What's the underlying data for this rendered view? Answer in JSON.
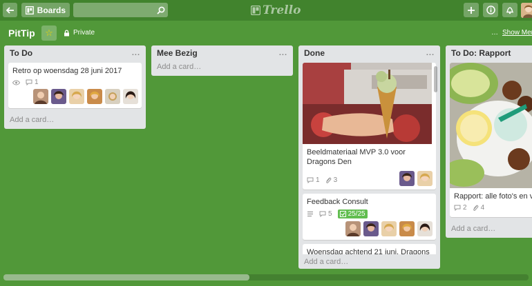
{
  "header": {
    "boards_label": "Boards",
    "logo_text": "Trello"
  },
  "board": {
    "title": "PitTip",
    "visibility": "Private",
    "menu_label": "Show Menu",
    "menu_dots": "…"
  },
  "lists": [
    {
      "title": "To Do",
      "menu": "...",
      "cards": [
        {
          "title": "Retro op woensdag 28 juni 2017",
          "comments": "1"
        }
      ],
      "add_card": "Add a card…"
    },
    {
      "title": "Mee Bezig",
      "menu": "...",
      "add_card": "Add a card…"
    },
    {
      "title": "Done",
      "menu": "...",
      "cards": [
        {
          "title": "Beeldmateriaal MVP 3.0 voor Dragons Den",
          "comments": "1",
          "attachments": "3"
        },
        {
          "title": "Feedback Consult",
          "comments": "5",
          "checklist": "25/25"
        },
        {
          "title": "Woensdag achtend 21 juni, Dragons"
        }
      ],
      "add_card": "Add a card…"
    },
    {
      "title": "To Do: Rapport",
      "cards": [
        {
          "title": "Rapport: alle foto's en v de presentatie",
          "comments": "2",
          "attachments": "4"
        }
      ],
      "add_card": "Add a card…"
    }
  ],
  "colors": {
    "board_bg": "#519839",
    "header_bg": "#41832d",
    "list_bg": "#e2e4e6",
    "checklist_done": "#61bd4f",
    "star": "#f2d600"
  }
}
